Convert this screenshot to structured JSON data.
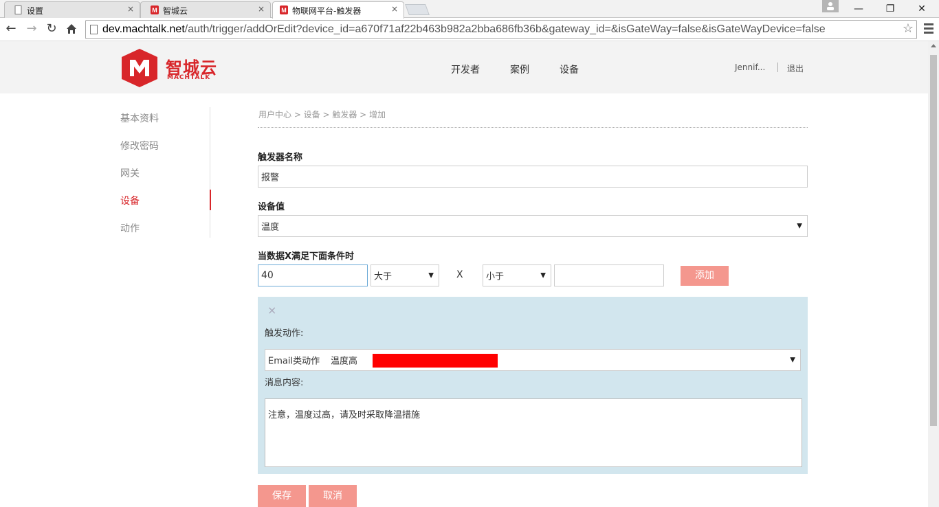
{
  "browser": {
    "tabs": [
      {
        "label": "设置",
        "close": "×"
      },
      {
        "label": "智城云",
        "close": "×"
      },
      {
        "label": "物联网平台-触发器",
        "close": "×"
      }
    ],
    "window_controls": {
      "minimize": "—",
      "restore": "❐",
      "close": "✕"
    },
    "url_host": "dev.machtalk.net",
    "url_path": "/auth/trigger/addOrEdit?device_id=a670f71af22b463b982a2bba686fb36b&gateway_id=&isGateWay=false&isGateWayDevice=false"
  },
  "header": {
    "logo_text": "智城云",
    "logo_sub": "MACHTALK",
    "nav": [
      "开发者",
      "案例",
      "设备"
    ],
    "user": "Jennif...",
    "logout": "退出"
  },
  "sidebar": {
    "items": [
      {
        "label": "基本资料"
      },
      {
        "label": "修改密码"
      },
      {
        "label": "网关"
      },
      {
        "label": "设备",
        "active": true
      },
      {
        "label": "动作"
      }
    ]
  },
  "breadcrumb": "用户中心 > 设备 > 触发器 > 增加",
  "form": {
    "name_label": "触发器名称",
    "name_value": "报警",
    "device_value_label": "设备值",
    "device_value_selected": "温度",
    "condition_label": "当数据X满足下面条件时",
    "cond_input_value": "40",
    "cond_op1": "大于",
    "x_label": "X",
    "cond_op2": "小于",
    "cond_input2_value": "",
    "add_button": "添加",
    "action_panel": {
      "close": "×",
      "action_label": "触发动作:",
      "action_type": "Email类动作",
      "action_name": "温度高",
      "message_label": "消息内容:",
      "message_value": "注意，温度过高，请及时采取降温措施"
    },
    "save_button": "保存",
    "cancel_button": "取消"
  },
  "colors": {
    "brand": "#d8262a",
    "button": "#f4978e",
    "panel_bg": "#d2e6ee"
  }
}
